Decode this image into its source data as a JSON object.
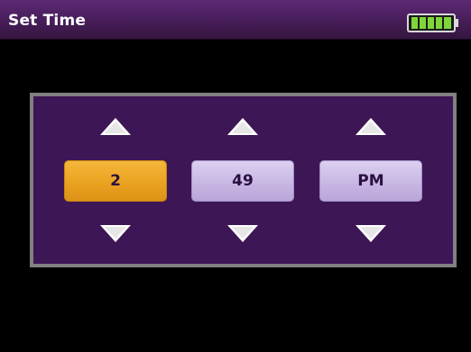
{
  "window": {
    "title": "Set Time",
    "battery_icon": "battery-full-icon",
    "battery_level": 1.0
  },
  "picker": {
    "selected_field": "hour",
    "fields": [
      {
        "id": "hour",
        "value": "2",
        "up_icon": "chevron-up-icon",
        "down_icon": "chevron-down-icon"
      },
      {
        "id": "minute",
        "value": "49",
        "up_icon": "chevron-up-icon",
        "down_icon": "chevron-down-icon"
      },
      {
        "id": "ampm",
        "value": "PM",
        "up_icon": "chevron-up-icon",
        "down_icon": "chevron-down-icon"
      }
    ]
  },
  "colors": {
    "title_bar": "#4a1f5f",
    "panel": "#3d1656",
    "panel_border": "#808080",
    "selected_field": "#eaa221",
    "normal_field": "#c6b5e2",
    "battery": "#7fd63a"
  }
}
